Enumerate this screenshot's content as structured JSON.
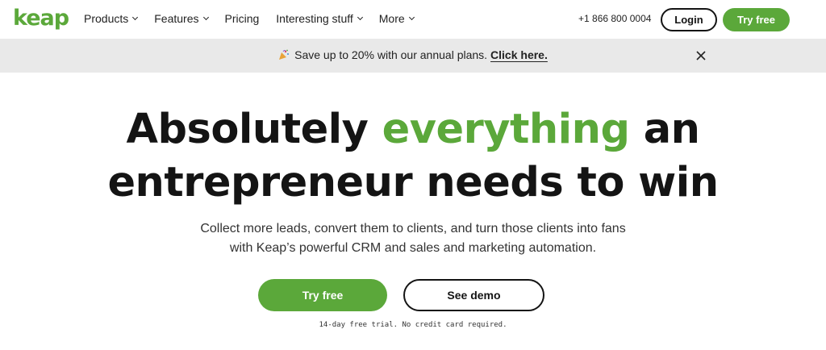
{
  "brand": {
    "logo_text": "keap",
    "accent_color": "#5ba83a"
  },
  "nav": {
    "items": [
      {
        "label": "Products",
        "has_dropdown": true
      },
      {
        "label": "Features",
        "has_dropdown": true
      },
      {
        "label": "Pricing",
        "has_dropdown": false
      },
      {
        "label": "Interesting stuff",
        "has_dropdown": true
      },
      {
        "label": "More",
        "has_dropdown": true
      }
    ],
    "phone": "+1 866 800 0004",
    "login_label": "Login",
    "try_free_label": "Try free"
  },
  "banner": {
    "icon": "party-popper-icon",
    "text": "Save up to 20% with our annual plans.",
    "link_label": "Click here.",
    "close_icon": "close-icon"
  },
  "hero": {
    "title_part1": "Absolutely ",
    "title_accent": "everything",
    "title_part2": " an",
    "title_line2": "entrepreneur needs to win",
    "subtitle_line1": "Collect more leads, convert them to clients, and turn those clients into fans",
    "subtitle_line2": "with Keap’s powerful CRM and sales and marketing automation.",
    "try_free_label": "Try free",
    "demo_label": "See demo",
    "fine_print": "14-day free trial. No credit card required."
  }
}
